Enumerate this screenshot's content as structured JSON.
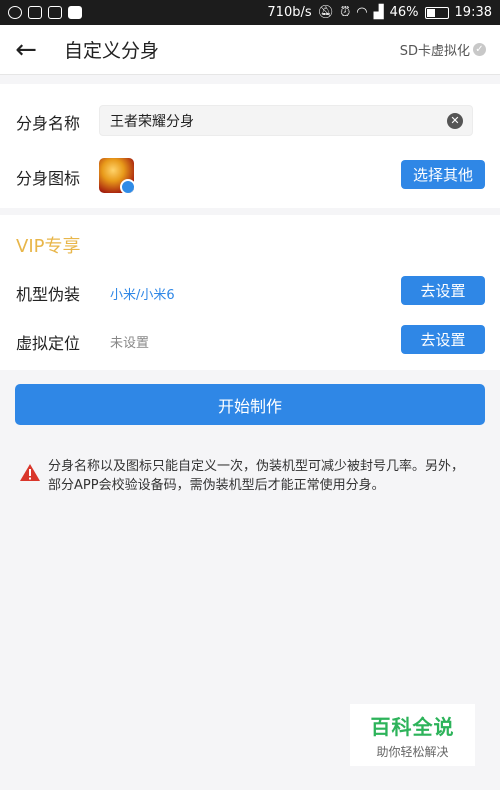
{
  "status_bar": {
    "speed": "710b/s",
    "battery": "46%",
    "time": "19:38",
    "icons": [
      "qq-icon",
      "message-icon",
      "image-icon",
      "s-app-icon",
      "mute-icon",
      "alarm-icon",
      "wifi-icon",
      "signal-icon",
      "battery-icon"
    ]
  },
  "header": {
    "back_icon": "←",
    "title": "自定义分身",
    "sd_label": "SD卡虚拟化",
    "sd_check": "✓"
  },
  "clone": {
    "name_label": "分身名称",
    "name_value": "王者荣耀分身",
    "icon_label": "分身图标",
    "choose_button": "选择其他"
  },
  "vip": {
    "heading": "VIP专享",
    "device_label": "机型伪装",
    "device_value": "小米/小米6",
    "device_button": "去设置",
    "location_label": "虚拟定位",
    "location_value": "未设置",
    "location_button": "去设置"
  },
  "start_button": "开始制作",
  "notice": "分身名称以及图标只能自定义一次，伪装机型可减少被封号几率。另外，部分APP会校验设备码，需伪装机型后才能正常使用分身。",
  "watermark": {
    "main": "百科全说",
    "sub": "助你轻松解决"
  },
  "colors": {
    "accent": "#2f87e6",
    "vip": "#e8b64a",
    "warning": "#d9362b",
    "watermark": "#2db35a"
  }
}
